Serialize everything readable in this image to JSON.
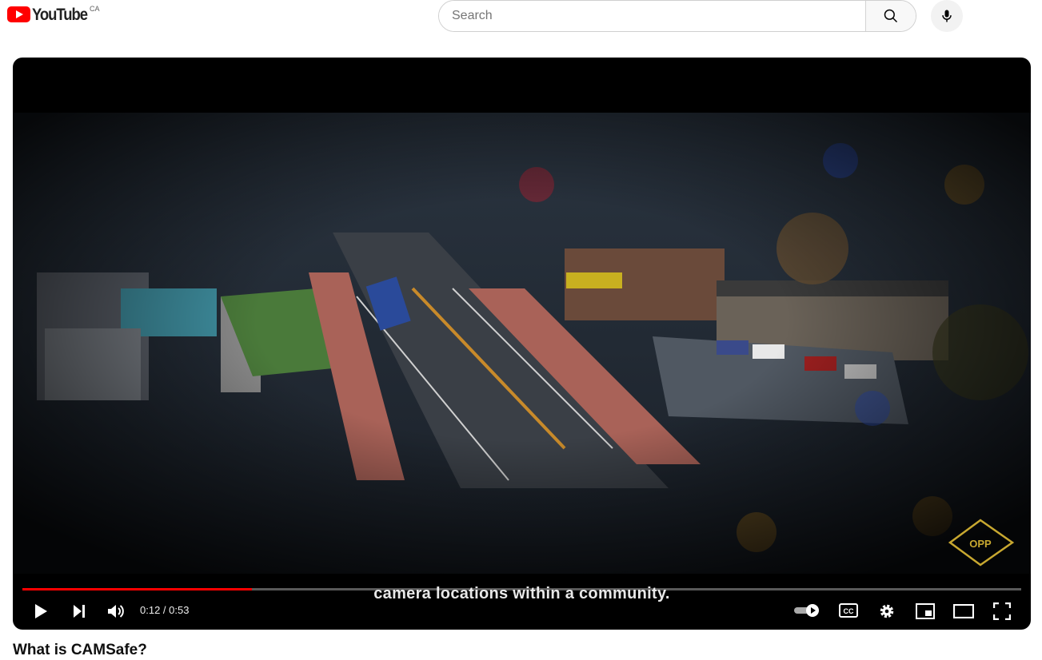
{
  "header": {
    "logo_text": "YouTube",
    "region": "CA",
    "search": {
      "placeholder": "Search",
      "value": ""
    },
    "search_icon": "search-icon",
    "mic_icon": "microphone-icon"
  },
  "player": {
    "subtitle": "camera locations within a community.",
    "time_display": "0:12 / 0:53",
    "progress_fraction": 0.23,
    "progress_color": "#ff0000",
    "watermark": "OPP",
    "controls_left": [
      "play-icon",
      "next-icon",
      "volume-icon"
    ],
    "controls_right": [
      "autoplay-toggle-icon",
      "captions-icon",
      "settings-icon",
      "miniplayer-icon",
      "theater-mode-icon",
      "fullscreen-icon"
    ],
    "captions_label": "CC"
  },
  "video": {
    "title": "What is CAMSafe?"
  }
}
